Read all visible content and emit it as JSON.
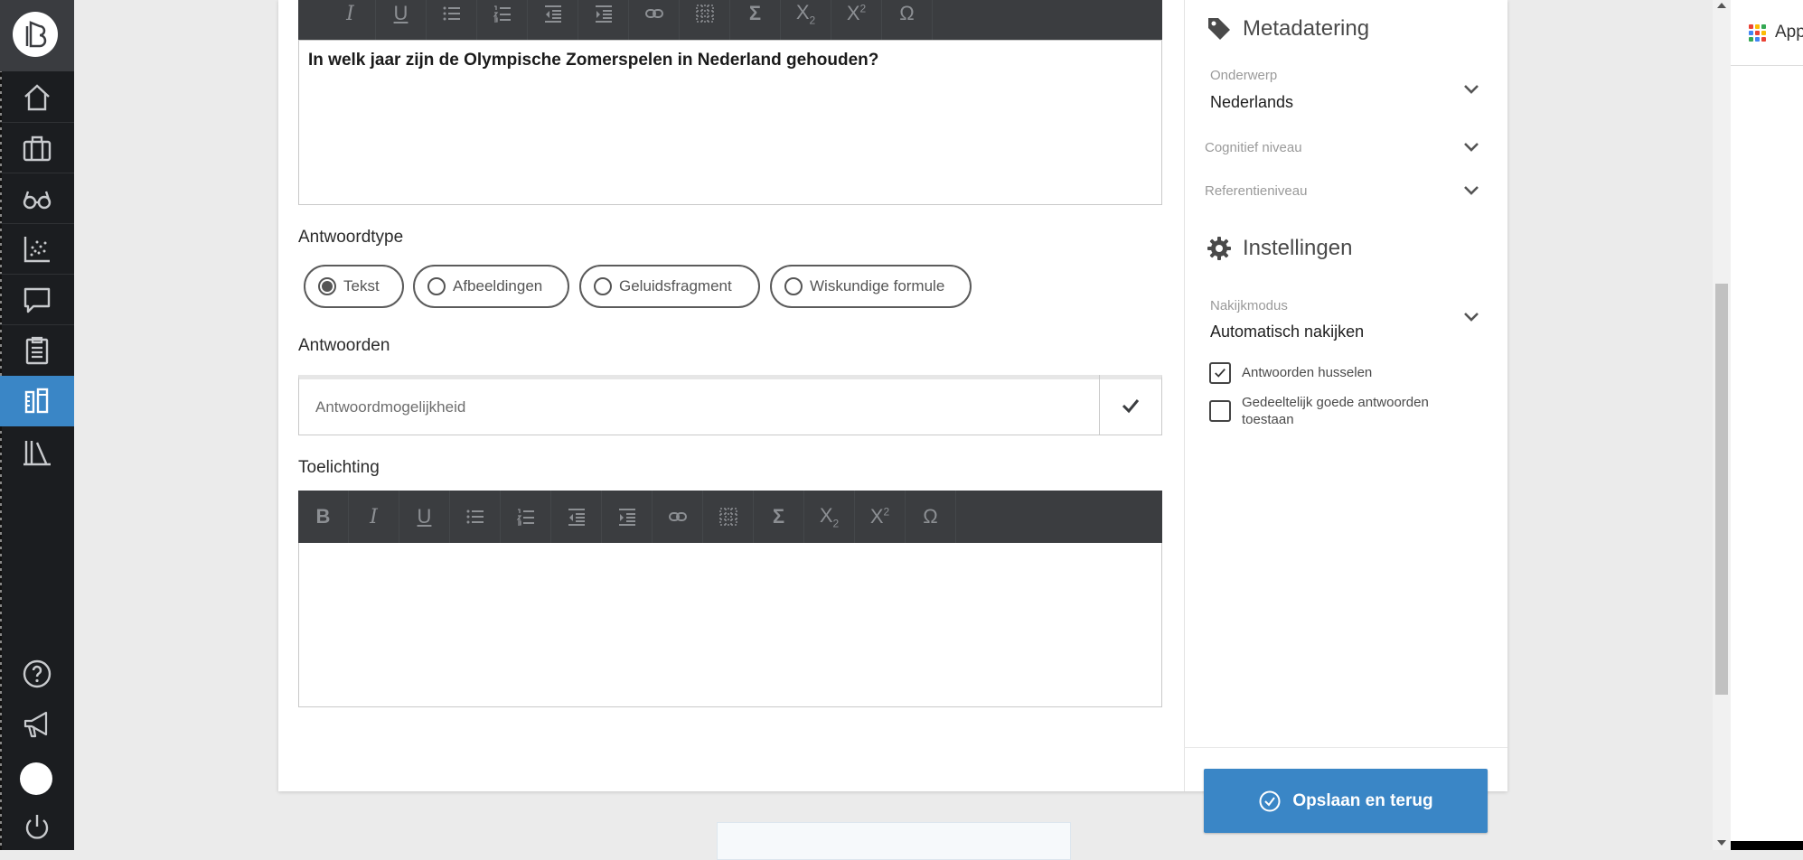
{
  "question": {
    "text": "In welk jaar zijn de Olympische Zomerspelen in Nederland gehouden?"
  },
  "answer_type": {
    "label": "Antwoordtype",
    "options": [
      {
        "label": "Tekst",
        "selected": true
      },
      {
        "label": "Afbeeldingen",
        "selected": false
      },
      {
        "label": "Geluidsfragment",
        "selected": false
      },
      {
        "label": "Wiskundige formule",
        "selected": false
      }
    ]
  },
  "answers": {
    "label": "Antwoorden",
    "placeholder": "Antwoordmogelijkheid"
  },
  "explanation": {
    "label": "Toelichting"
  },
  "toolbar": {
    "buttons": [
      "bold-icon",
      "italic-icon",
      "underline-icon",
      "bullet-list-icon",
      "numbered-list-icon",
      "outdent-icon",
      "indent-icon",
      "link-icon",
      "table-icon",
      "sigma-icon",
      "subscript-icon",
      "superscript-icon",
      "omega-icon"
    ]
  },
  "metadata": {
    "heading": "Metadatering",
    "subject_label": "Onderwerp",
    "subject_value": "Nederlands",
    "cognitive_label": "Cognitief niveau",
    "reference_label": "Referentieniveau"
  },
  "settings": {
    "heading": "Instellingen",
    "grading_label": "Nakijkmodus",
    "grading_value": "Automatisch nakijken",
    "shuffle_label": "Antwoorden husselen",
    "shuffle_checked": true,
    "partial_label": "Gedeeltelijk goede antwoorden toestaan",
    "partial_checked": false
  },
  "save_button": {
    "label": "Opslaan en terug"
  },
  "browser": {
    "apps_label": "App"
  },
  "colors": {
    "accent": "#3a86c6",
    "nav_bg": "#1b1d20",
    "toolbar_bg": "#3b3d40"
  }
}
